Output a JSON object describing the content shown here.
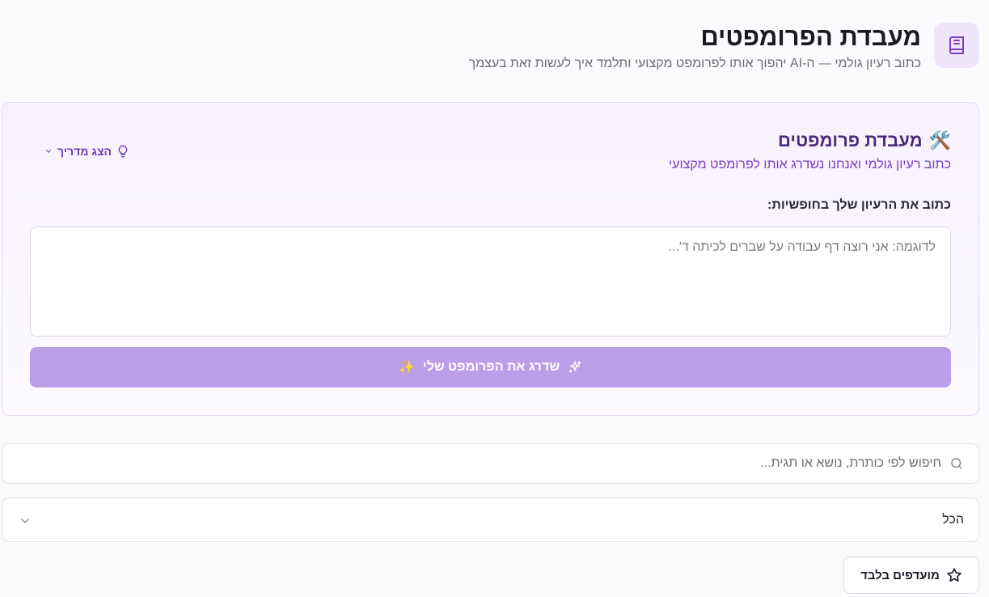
{
  "header": {
    "title": "מעבדת הפרומפטים",
    "subtitle": "כתוב רעיון גולמי — ה-AI יהפוך אותו לפרומפט מקצועי ותלמד איך לעשות זאת בעצמך",
    "icon": "book-icon"
  },
  "lab": {
    "emoji": "🛠️",
    "title": "מעבדת פרומפטים",
    "subtitle": "כתוב רעיון גולמי ואנחנו נשדרג אותו לפרומפט מקצועי",
    "guide_toggle": "הצג מדריך",
    "field_label": "כתוב את הרעיון שלך בחופשיות:",
    "idea_placeholder": "לדוגמה: אני רוצה דף עבודה על שברים לכיתה ד'...",
    "idea_value": "",
    "upgrade_button": "שדרג את הפרומפט שלי",
    "upgrade_button_emoji": "✨"
  },
  "search": {
    "placeholder": "חיפוש לפי כותרת, נושא או תגית...",
    "value": ""
  },
  "filter": {
    "selected": "הכל"
  },
  "favorites": {
    "label": "מועדפים בלבד"
  },
  "colors": {
    "accent": "#7a3fc9",
    "button": "#bb9ee8",
    "card_border": "#e5d7f5"
  }
}
